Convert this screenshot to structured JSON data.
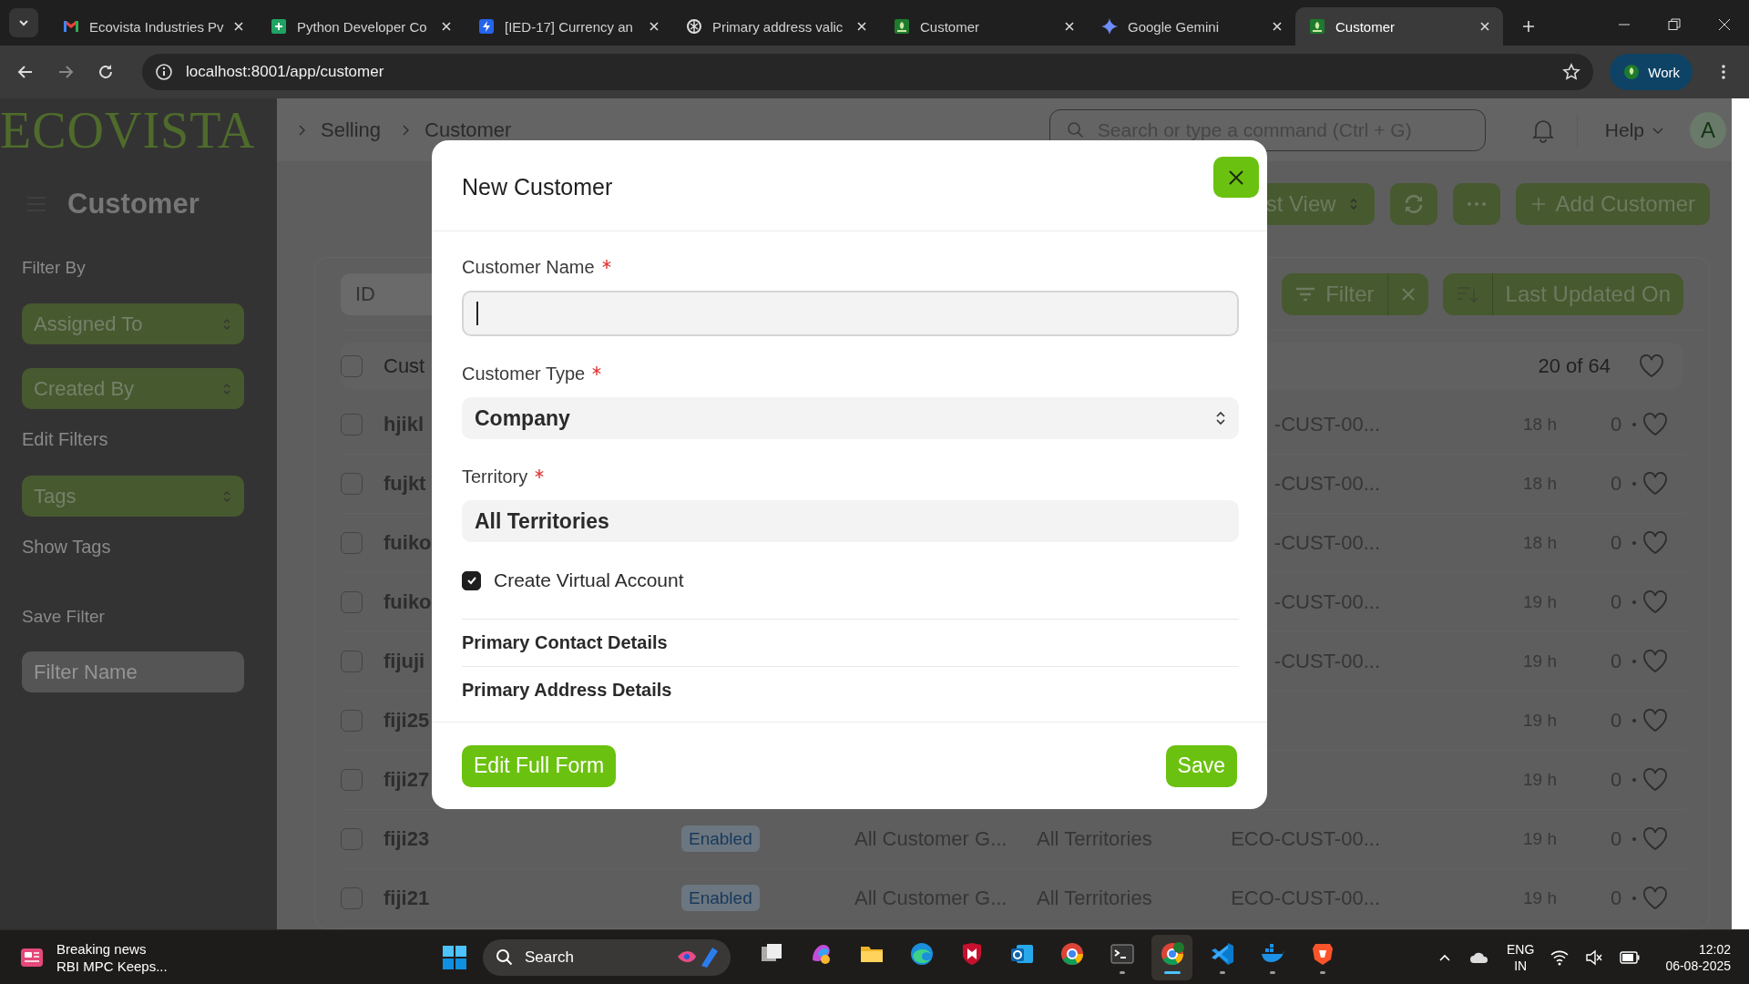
{
  "browser": {
    "tabs": [
      {
        "title": "Ecovista Industries Pv",
        "selected": false
      },
      {
        "title": "Python Developer Co",
        "selected": false
      },
      {
        "title": "[IED-17] Currency an",
        "selected": false
      },
      {
        "title": "Primary address valic",
        "selected": false
      },
      {
        "title": "Customer",
        "selected": false
      },
      {
        "title": "Google Gemini",
        "selected": false
      },
      {
        "title": "Customer",
        "selected": true
      }
    ],
    "address": "localhost:8001/app/customer",
    "profile": "Work"
  },
  "navbar": {
    "logo": "ECOVISTA",
    "breadcrumbs": [
      "Selling",
      "Customer"
    ],
    "search_placeholder": "Search or type a command (Ctrl + G)",
    "help": "Help",
    "avatar": "A"
  },
  "sidebar": {
    "title": "Customer",
    "filter_by": "Filter By",
    "filters": [
      "Assigned To",
      "Created By"
    ],
    "edit_filters": "Edit Filters",
    "tags": "Tags",
    "show_tags": "Show Tags",
    "save_filter": "Save Filter",
    "filter_name_placeholder": "Filter Name"
  },
  "page_actions": {
    "view": "st View",
    "add": "Add Customer"
  },
  "list": {
    "id_placeholder": "ID",
    "filter": "Filter",
    "sort": "Last Updated On",
    "header": "Cust",
    "all_checked": false,
    "count": "20 of 64",
    "rows": [
      {
        "checked": false,
        "name": "hjikl",
        "id": "-CUST-00...",
        "modified": "18 h",
        "comments": "0"
      },
      {
        "checked": false,
        "name": "fujkt",
        "id": "-CUST-00...",
        "modified": "18 h",
        "comments": "0"
      },
      {
        "checked": false,
        "name": "fuiko",
        "id": "-CUST-00...",
        "modified": "18 h",
        "comments": "0"
      },
      {
        "checked": false,
        "name": "fuiko",
        "id": "-CUST-00...",
        "modified": "19 h",
        "comments": "0"
      },
      {
        "checked": false,
        "name": "fijuji",
        "id": "-CUST-00...",
        "modified": "19 h",
        "comments": "0"
      },
      {
        "checked": false,
        "name": "fiji25",
        "modified": "19 h",
        "comments": "0"
      },
      {
        "checked": false,
        "name": "fiji27",
        "modified": "19 h",
        "comments": "0"
      },
      {
        "checked": false,
        "name": "fiji23",
        "status": "Enabled",
        "group": "All Customer G...",
        "territory": "All Territories",
        "id": "ECO-CUST-00...",
        "modified": "19 h",
        "comments": "0"
      },
      {
        "checked": false,
        "name": "fiji21",
        "status": "Enabled",
        "group": "All Customer G...",
        "territory": "All Territories",
        "id": "ECO-CUST-00...",
        "modified": "19 h",
        "comments": "0"
      }
    ]
  },
  "dialog": {
    "title": "New Customer",
    "fields": [
      {
        "kind": "text",
        "label": "Customer Name",
        "required": true,
        "focused": true
      },
      {
        "kind": "select",
        "label": "Customer Type",
        "required": true,
        "value": "Company"
      },
      {
        "kind": "link",
        "label": "Territory",
        "required": true,
        "value": "All Territories"
      }
    ],
    "checkbox": {
      "label": "Create Virtual Account",
      "checked": true
    },
    "sections": [
      "Primary Contact Details",
      "Primary Address Details"
    ],
    "secondary_button": "Edit Full Form",
    "primary_button": "Save"
  },
  "taskbar": {
    "news_title": "Breaking news",
    "news_text": "RBI MPC Keeps...",
    "search": "Search",
    "apps": [
      {
        "running": false,
        "selected": false
      },
      {
        "running": false,
        "selected": false
      },
      {
        "running": false,
        "selected": false
      },
      {
        "running": false,
        "selected": false
      },
      {
        "running": false,
        "selected": false
      },
      {
        "running": false,
        "selected": false
      },
      {
        "running": false,
        "selected": false
      },
      {
        "running": true,
        "selected": false
      },
      {
        "running": true,
        "selected": true
      },
      {
        "running": true,
        "selected": false
      },
      {
        "running": true,
        "selected": false
      },
      {
        "running": true,
        "selected": false
      }
    ],
    "lang": "ENG",
    "region": "IN",
    "time": "12:02",
    "date": "06-08-2025"
  }
}
